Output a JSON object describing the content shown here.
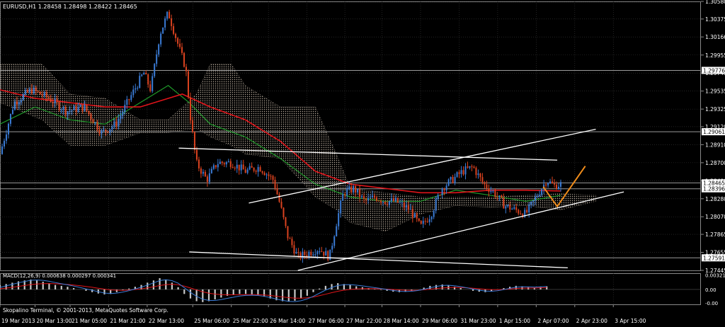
{
  "chart_data": {
    "type": "candlestick",
    "symbol_header": "EURUSD,H1  1.28458 1.28498 1.28422 1.28465",
    "copyright": "Skopalino Terminal, © 2001-2013, MetaQuotes Software Corp.",
    "ylim": [
      1.27445,
      1.3058
    ],
    "price_ticks": [
      "1.30580",
      "1.30375",
      "1.30166",
      "1.29955",
      "1.29745",
      "1.29535",
      "1.29325",
      "1.29120",
      "1.28910",
      "1.28700",
      "1.28490",
      "1.28280",
      "1.28070",
      "1.27865",
      "1.27655",
      "1.27445"
    ],
    "price_tick_values": [
      1.3058,
      1.30375,
      1.30166,
      1.29955,
      1.29745,
      1.29535,
      1.29325,
      1.2912,
      1.2891,
      1.287,
      1.2849,
      1.2828,
      1.2807,
      1.27865,
      1.27655,
      1.27445
    ],
    "horizontal_levels": [
      {
        "label": "1.29776",
        "value": 1.29776
      },
      {
        "label": "1.29061",
        "value": 1.29061
      },
      {
        "label": "1.28465",
        "value": 1.28465
      },
      {
        "label": "1.28396",
        "value": 1.28396
      },
      {
        "label": "1.27591",
        "value": 1.27591
      }
    ],
    "time_labels": [
      "19 Mar 2013",
      "20 Mar 13:00",
      "21 Mar 05:00",
      "21 Mar 21:00",
      "22 Mar 13:00",
      "25 Mar 06:00",
      "25 Mar 22:00",
      "26 Mar 14:00",
      "27 Mar 06:00",
      "27 Mar 22:00",
      "28 Mar 14:00",
      "29 Mar 06:00",
      "31 Mar 23:00",
      "1 Apr 15:00",
      "2 Apr 07:00",
      "2 Apr 23:00",
      "3 Apr 15:00"
    ],
    "time_label_pos": [
      0.0,
      0.05,
      0.1,
      0.155,
      0.21,
      0.275,
      0.33,
      0.383,
      0.438,
      0.492,
      0.545,
      0.6,
      0.655,
      0.71,
      0.765,
      0.82,
      0.875
    ],
    "close_path": [
      [
        0.0,
        1.288
      ],
      [
        0.02,
        1.294
      ],
      [
        0.045,
        1.2955
      ],
      [
        0.07,
        1.2945
      ],
      [
        0.095,
        1.293
      ],
      [
        0.12,
        1.2935
      ],
      [
        0.145,
        1.2905
      ],
      [
        0.165,
        1.2915
      ],
      [
        0.185,
        1.2945
      ],
      [
        0.205,
        1.2975
      ],
      [
        0.215,
        1.2955
      ],
      [
        0.228,
        1.302
      ],
      [
        0.24,
        1.3045
      ],
      [
        0.255,
        1.3005
      ],
      [
        0.265,
        1.298
      ],
      [
        0.272,
        1.292
      ],
      [
        0.28,
        1.287
      ],
      [
        0.295,
        1.285
      ],
      [
        0.31,
        1.287
      ],
      [
        0.33,
        1.287
      ],
      [
        0.35,
        1.286
      ],
      [
        0.37,
        1.2865
      ],
      [
        0.39,
        1.285
      ],
      [
        0.4,
        1.282
      ],
      [
        0.41,
        1.2785
      ],
      [
        0.425,
        1.276
      ],
      [
        0.44,
        1.2765
      ],
      [
        0.455,
        1.277
      ],
      [
        0.47,
        1.276
      ],
      [
        0.48,
        1.28
      ],
      [
        0.49,
        1.2835
      ],
      [
        0.505,
        1.284
      ],
      [
        0.52,
        1.2825
      ],
      [
        0.535,
        1.283
      ],
      [
        0.55,
        1.2825
      ],
      [
        0.565,
        1.2825
      ],
      [
        0.585,
        1.2815
      ],
      [
        0.6,
        1.2795
      ],
      [
        0.615,
        1.281
      ],
      [
        0.63,
        1.284
      ],
      [
        0.645,
        1.285
      ],
      [
        0.66,
        1.286
      ],
      [
        0.675,
        1.2865
      ],
      [
        0.69,
        1.2845
      ],
      [
        0.705,
        1.2835
      ],
      [
        0.72,
        1.282
      ],
      [
        0.735,
        1.2815
      ],
      [
        0.75,
        1.281
      ],
      [
        0.765,
        1.283
      ],
      [
        0.78,
        1.285
      ],
      [
        0.79,
        1.2843
      ],
      [
        0.8,
        1.2845
      ]
    ],
    "red_ma": [
      [
        0.0,
        1.2955
      ],
      [
        0.05,
        1.2945
      ],
      [
        0.1,
        1.294
      ],
      [
        0.15,
        1.2935
      ],
      [
        0.2,
        1.2935
      ],
      [
        0.24,
        1.2945
      ],
      [
        0.26,
        1.295
      ],
      [
        0.3,
        1.2935
      ],
      [
        0.35,
        1.292
      ],
      [
        0.4,
        1.2895
      ],
      [
        0.45,
        1.286
      ],
      [
        0.5,
        1.2845
      ],
      [
        0.55,
        1.284
      ],
      [
        0.6,
        1.2835
      ],
      [
        0.65,
        1.2835
      ],
      [
        0.7,
        1.2838
      ],
      [
        0.75,
        1.2838
      ],
      [
        0.8,
        1.2837
      ]
    ],
    "green_ma": [
      [
        0.0,
        1.2915
      ],
      [
        0.05,
        1.2935
      ],
      [
        0.1,
        1.292
      ],
      [
        0.15,
        1.2915
      ],
      [
        0.2,
        1.294
      ],
      [
        0.24,
        1.296
      ],
      [
        0.27,
        1.294
      ],
      [
        0.3,
        1.2915
      ],
      [
        0.35,
        1.29
      ],
      [
        0.4,
        1.2875
      ],
      [
        0.45,
        1.2845
      ],
      [
        0.5,
        1.283
      ],
      [
        0.55,
        1.2825
      ],
      [
        0.6,
        1.2825
      ],
      [
        0.65,
        1.2838
      ],
      [
        0.7,
        1.2832
      ],
      [
        0.75,
        1.2825
      ],
      [
        0.8,
        1.2832
      ]
    ],
    "ichimoku_cloud_upper": [
      [
        0.0,
        1.2985
      ],
      [
        0.06,
        1.2985
      ],
      [
        0.1,
        1.295
      ],
      [
        0.15,
        1.2945
      ],
      [
        0.2,
        1.292
      ],
      [
        0.24,
        1.292
      ],
      [
        0.28,
        1.295
      ],
      [
        0.3,
        1.2985
      ],
      [
        0.33,
        1.2985
      ],
      [
        0.35,
        1.296
      ],
      [
        0.4,
        1.2935
      ],
      [
        0.45,
        1.2935
      ],
      [
        0.48,
        1.288
      ],
      [
        0.5,
        1.284
      ],
      [
        0.55,
        1.2835
      ],
      [
        0.6,
        1.283
      ],
      [
        0.65,
        1.283
      ],
      [
        0.7,
        1.283
      ],
      [
        0.75,
        1.2832
      ],
      [
        0.8,
        1.2834
      ],
      [
        0.85,
        1.2832
      ]
    ],
    "ichimoku_cloud_lower": [
      [
        0.0,
        1.294
      ],
      [
        0.06,
        1.292
      ],
      [
        0.1,
        1.289
      ],
      [
        0.15,
        1.289
      ],
      [
        0.2,
        1.2905
      ],
      [
        0.24,
        1.2905
      ],
      [
        0.28,
        1.291
      ],
      [
        0.3,
        1.29
      ],
      [
        0.33,
        1.289
      ],
      [
        0.35,
        1.288
      ],
      [
        0.4,
        1.2875
      ],
      [
        0.45,
        1.283
      ],
      [
        0.48,
        1.2815
      ],
      [
        0.5,
        1.28
      ],
      [
        0.55,
        1.279
      ],
      [
        0.6,
        1.281
      ],
      [
        0.65,
        1.282
      ],
      [
        0.7,
        1.2818
      ],
      [
        0.75,
        1.282
      ],
      [
        0.8,
        1.2815
      ],
      [
        0.85,
        1.2825
      ]
    ],
    "trend_lines": [
      {
        "color": "#ffffff",
        "x1": 0.255,
        "y1": 1.2887,
        "x2": 0.795,
        "y2": 1.2873
      },
      {
        "color": "#ffffff",
        "x1": 0.27,
        "y1": 1.2766,
        "x2": 0.81,
        "y2": 1.27475
      },
      {
        "color": "#ffffff",
        "x1": 0.355,
        "y1": 1.2823,
        "x2": 0.85,
        "y2": 1.2909
      },
      {
        "color": "#ffffff",
        "x1": 0.425,
        "y1": 1.27445,
        "x2": 0.89,
        "y2": 1.2836
      }
    ],
    "forecast_path": [
      [
        0.775,
        1.2842
      ],
      [
        0.795,
        1.2819
      ],
      [
        0.835,
        1.2866
      ]
    ],
    "colors": {
      "background": "#000000",
      "bull": "#3a7bd5",
      "bear": "#d9421f",
      "red_ma": "#e0141a",
      "green_ma": "#1f9a2a",
      "cloud": "#b5a99a",
      "grid": "#3a3a3a",
      "axis_text": "#ffffff",
      "forecast": "#f08c1a",
      "level_line": "#9a9a9a"
    },
    "macd": {
      "label": "MACD(12,26,9) 0.000638 0.000297 0.000341",
      "ticks": [
        "0.003211",
        "0.00",
        "-0.00"
      ],
      "tick_values": [
        0.003211,
        0.0,
        -0.003
      ],
      "ylim": [
        -0.0033,
        0.0036
      ],
      "signal_value": 0.000297,
      "main_value": 0.000638,
      "histogram": [
        0.001,
        0.0012,
        0.0015,
        0.0018,
        0.002,
        0.0022,
        0.002,
        0.0017,
        0.0014,
        0.001,
        0.0008,
        0.0006,
        0.0003,
        0.0,
        -0.0003,
        -0.0006,
        -0.0009,
        -0.0011,
        -0.001,
        -0.0006,
        -0.0002,
        0.0002,
        0.0006,
        0.001,
        0.0015,
        0.002,
        0.0025,
        0.0022,
        0.0015,
        0.0005,
        -0.001,
        -0.002,
        -0.0026,
        -0.0028,
        -0.0026,
        -0.0022,
        -0.0018,
        -0.0014,
        -0.0012,
        -0.001,
        -0.001,
        -0.0011,
        -0.0013,
        -0.0016,
        -0.002,
        -0.0024,
        -0.0026,
        -0.0027,
        -0.0025,
        -0.002,
        -0.0014,
        -0.0006,
        0.0002,
        0.0008,
        0.0012,
        0.0014,
        0.0012,
        0.001,
        0.0007,
        0.0005,
        0.0003,
        0.0001,
        -0.0001,
        -0.0003,
        -0.0005,
        -0.0006,
        -0.0005,
        -0.0003,
        0.0,
        0.0004,
        0.0008,
        0.001,
        0.0011,
        0.0009,
        0.0006,
        0.0003,
        0.0,
        -0.0003,
        -0.0005,
        -0.0006,
        -0.0004,
        -0.0001,
        0.0003,
        0.0006,
        0.0008,
        0.0007,
        0.0005,
        0.0004,
        0.0006,
        0.0007
      ]
    }
  }
}
